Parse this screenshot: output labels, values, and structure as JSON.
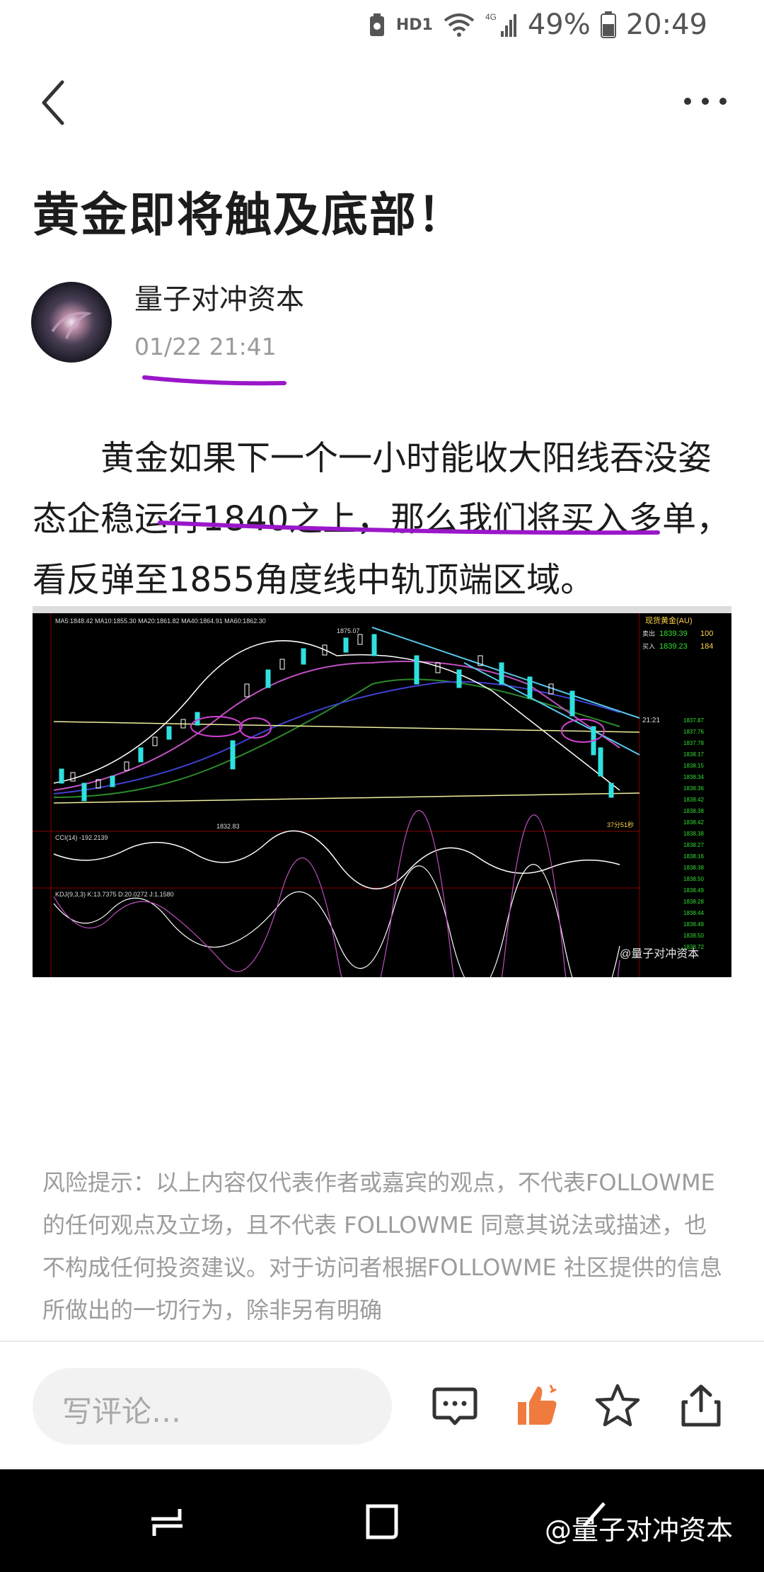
{
  "status_bar": {
    "hd_label": "HD1",
    "network": "4G",
    "battery": "49%",
    "time": "20:49"
  },
  "article": {
    "title": "黄金即将触及底部！",
    "author": "量子对冲资本",
    "date": "01/22 21:41",
    "body": "黄金如果下一个一小时能收大阳线吞没姿态企稳运行1840之上，那么我们将买入多单，看反弹至1855角度线中轨顶端区域。"
  },
  "chart_image": {
    "panel_title": "现货黄金(AU)",
    "sell_label": "卖出",
    "sell_price": "1839.39",
    "sell_qty": "100",
    "buy_label": "买入",
    "buy_price": "1839.23",
    "buy_qty": "184",
    "ma_line": "MA5:1848.42  MA10:1855.30  MA20:1861.82  MA40:1864.91  MA60:1862.30",
    "high_label": "1875.07",
    "low_label": "1832.83",
    "cci_label": "CCI(14) -192.2139",
    "kdj_label": "KDJ(9,3,3) K:13.7375 D:20.0272 J:1.1580",
    "time_label": "21:21",
    "countdown": "37分51秒",
    "watermark": "@量子对冲资本"
  },
  "risk_notice": "风险提示：以上内容仅代表作者或嘉宾的观点，不代表FOLLOWME 的任何观点及立场，且不代表 FOLLOWME 同意其说法或描述，也不构成任何投资建议。对于访问者根据FOLLOWME 社区提供的信息所做出的一切行为，除非另有明确",
  "bottom_bar": {
    "comment_placeholder": "写评论…"
  },
  "nav_watermark": "@量子对冲资本",
  "colors": {
    "like_orange": "#f07b3f",
    "underline_purple": "#9a17c9",
    "chart_bg": "#000000"
  }
}
